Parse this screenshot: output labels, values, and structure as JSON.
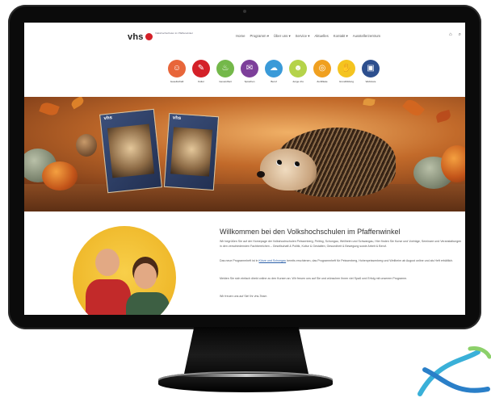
{
  "header": {
    "logo": "vhs",
    "tagline": "Volkshochschulen im Pfaffenwinkel",
    "nav": [
      "Home",
      "Programm ▾",
      "Über uns ▾",
      "Service ▾",
      "Aktuelles",
      "Kontakt ▾",
      "Ausstellerzentrum"
    ],
    "search_icon": "search-icon",
    "cart_icon": "bag-icon"
  },
  "categories": [
    {
      "label": "Gesellschaft",
      "color": "#e8663a",
      "glyph": "☺"
    },
    {
      "label": "Kultur",
      "color": "#d42028",
      "glyph": "✎"
    },
    {
      "label": "Gesundheit",
      "color": "#74b84a",
      "glyph": "♨"
    },
    {
      "label": "Sprachen",
      "color": "#7d3f9a",
      "glyph": "✉"
    },
    {
      "label": "Beruf",
      "color": "#3a9ad8",
      "glyph": "☁"
    },
    {
      "label": "Junge vhs",
      "color": "#b5d34a",
      "glyph": "☻"
    },
    {
      "label": "Zertifikate",
      "color": "#f0a020",
      "glyph": "◎"
    },
    {
      "label": "Grundbildung",
      "color": "#f4c420",
      "glyph": "✋"
    },
    {
      "label": "Webinare",
      "color": "#2d4f8e",
      "glyph": "▣"
    }
  ],
  "hero": {
    "book_label": "vhs"
  },
  "welcome": {
    "title": "Willkommen bei den Volkshochschulen im Pfaffenwinkel",
    "p1": "Wir begrüßen Sie auf der Homepage der Volkshochschulen Peissenberg, Peiting, Schongau, Weilheim und Schwangau, Hier finden Sie Kurse und Vorträge, Seminare und Veranstaltungen in den verschiedensten Fachbereichen – Gesellschaft & Politik, Kultur & Gestalten, Gesundheit & Bewegung sowie Arbeit & Beruf.",
    "p2_pre": "Das neue Programmheft ist in ",
    "p2_link": "Kürze und Schongau",
    "p2_post": " bereits erschienen, das Programmheft für Peissenberg, Hohenpeissenberg und Weilheim ab August online und als Heft erhältlich.",
    "p3": "Melden Sie sich einfach direkt online zu den Kursen an. Wir freuen uns auf Sie und wünschen Ihnen viel Spaß und Erfolg mit unserem Programm.",
    "p4": "Wir freuen uns auf Sie! Ihr vhs-Team"
  },
  "colors": {
    "vhs_red": "#d42028",
    "link": "#2b5fa8"
  }
}
